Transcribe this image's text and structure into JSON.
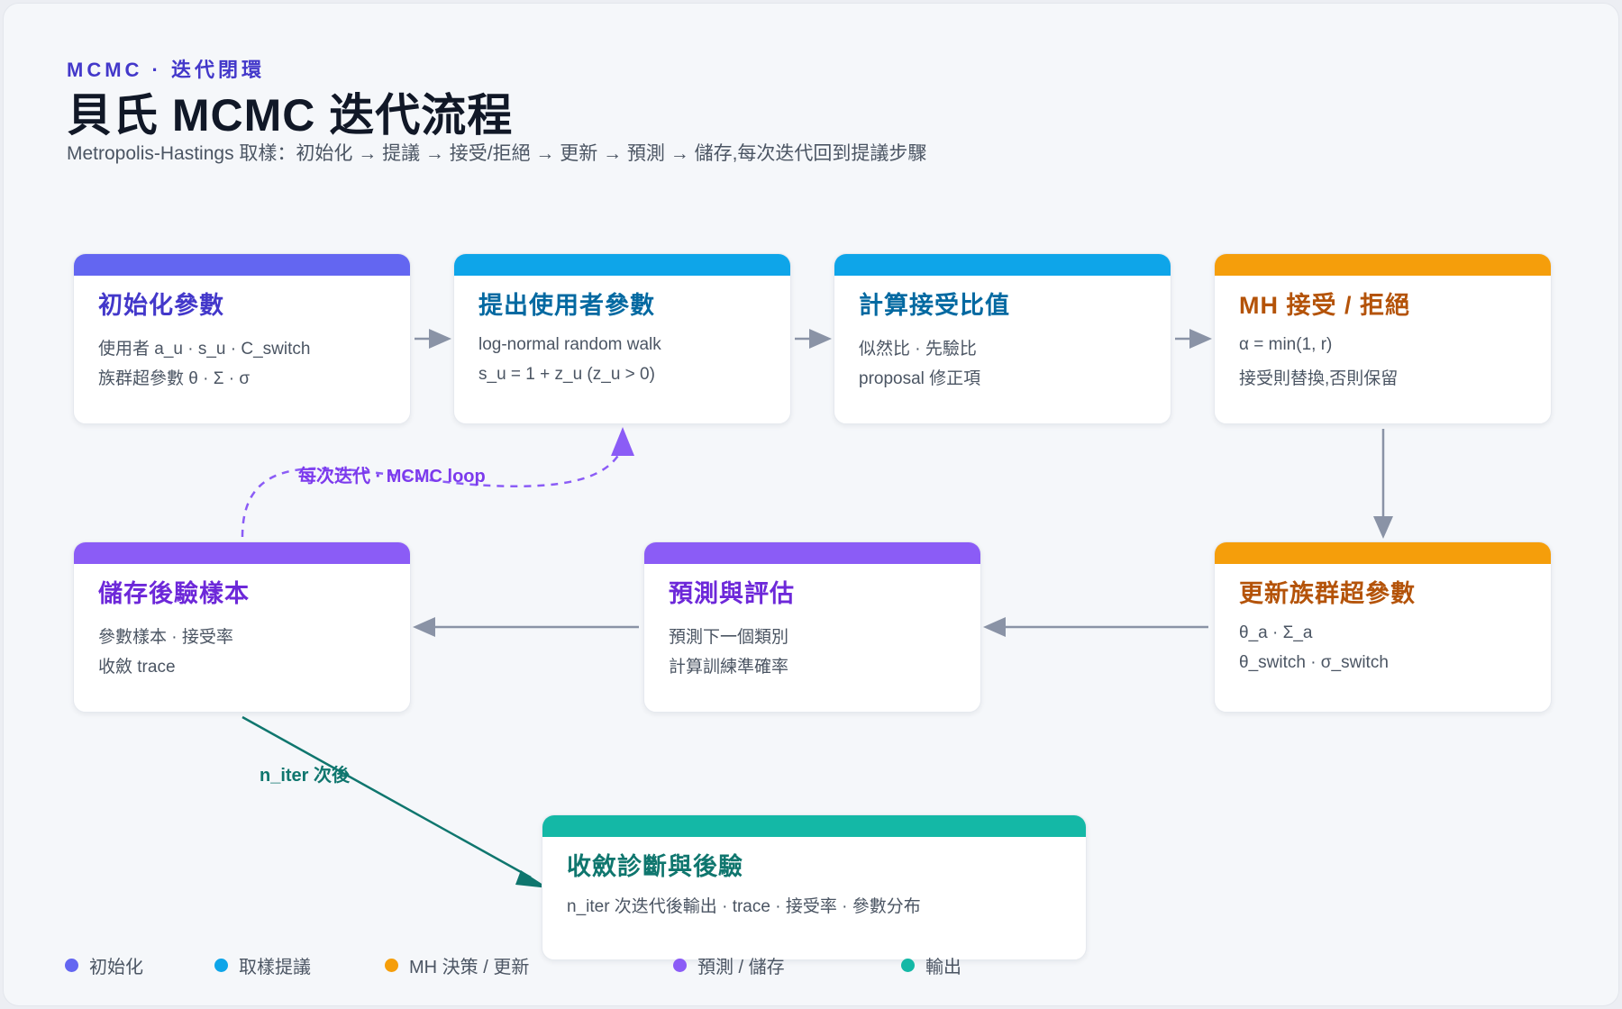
{
  "header": {
    "eyebrow": "MCMC · 迭代閉環",
    "title": "貝氏 MCMC 迭代流程",
    "subtitle": "Metropolis-Hastings 取樣：初始化 → 提議 → 接受/拒絕 → 更新 → 預測 → 儲存,每次迭代回到提議步驟"
  },
  "colors": {
    "init": "#6366f1",
    "proposal": "#0ea5e9",
    "decision": "#f59e0b",
    "predict": "#8b5cf6",
    "output": "#14b8a6"
  },
  "nodes": {
    "init": {
      "title": "初始化參數",
      "line1": "使用者 a_u · s_u · C_switch",
      "line2": "族群超參數 θ · Σ · σ"
    },
    "propose": {
      "title": "提出使用者參數",
      "line1": "log-normal random walk",
      "line2": "s_u = 1 + z_u (z_u > 0)"
    },
    "ratio": {
      "title": "計算接受比值",
      "line1": "似然比 · 先驗比",
      "line2": "proposal 修正項"
    },
    "mh": {
      "title": "MH 接受 / 拒絕",
      "line1": "α = min(1, r)",
      "line2": "接受則替換,否則保留"
    },
    "update": {
      "title": "更新族群超參數",
      "line1": "θ_a · Σ_a",
      "line2": "θ_switch · σ_switch"
    },
    "predict": {
      "title": "預測與評估",
      "line1": "預測下一個類別",
      "line2": "計算訓練準確率"
    },
    "store": {
      "title": "儲存後驗樣本",
      "line1": "參數樣本 · 接受率",
      "line2": "收斂 trace"
    },
    "converge": {
      "title": "收斂診斷與後驗",
      "line1": "n_iter 次迭代後輸出 · trace · 接受率 · 參數分布"
    }
  },
  "edges": {
    "loop_label": "每次迭代 · MCMC loop",
    "niter_label": "n_iter 次後"
  },
  "legend": [
    {
      "label": "初始化",
      "color": "#6366f1"
    },
    {
      "label": "取樣提議",
      "color": "#0ea5e9"
    },
    {
      "label": "MH 決策 / 更新",
      "color": "#f59e0b"
    },
    {
      "label": "預測 / 儲存",
      "color": "#8b5cf6"
    },
    {
      "label": "輸出",
      "color": "#14b8a6"
    }
  ]
}
